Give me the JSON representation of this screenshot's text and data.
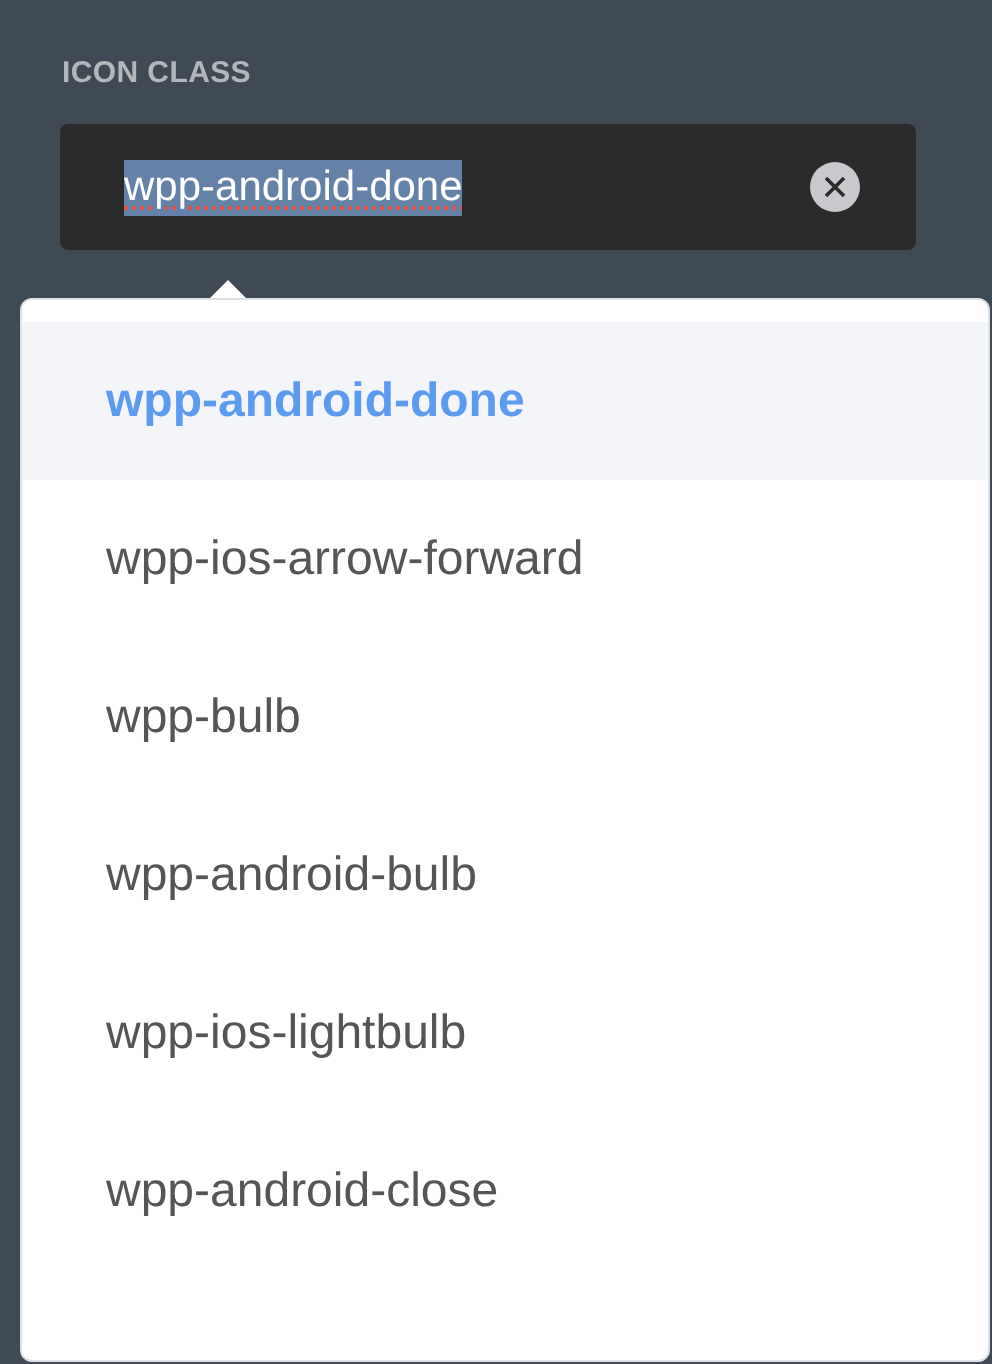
{
  "field": {
    "label": "ICON CLASS",
    "value": "wpp-android-done"
  },
  "suggestions": [
    {
      "label": "wpp-android-done",
      "selected": true
    },
    {
      "label": "wpp-ios-arrow-forward",
      "selected": false
    },
    {
      "label": "wpp-bulb",
      "selected": false
    },
    {
      "label": "wpp-android-bulb",
      "selected": false
    },
    {
      "label": "wpp-ios-lightbulb",
      "selected": false
    },
    {
      "label": "wpp-android-close",
      "selected": false
    }
  ]
}
